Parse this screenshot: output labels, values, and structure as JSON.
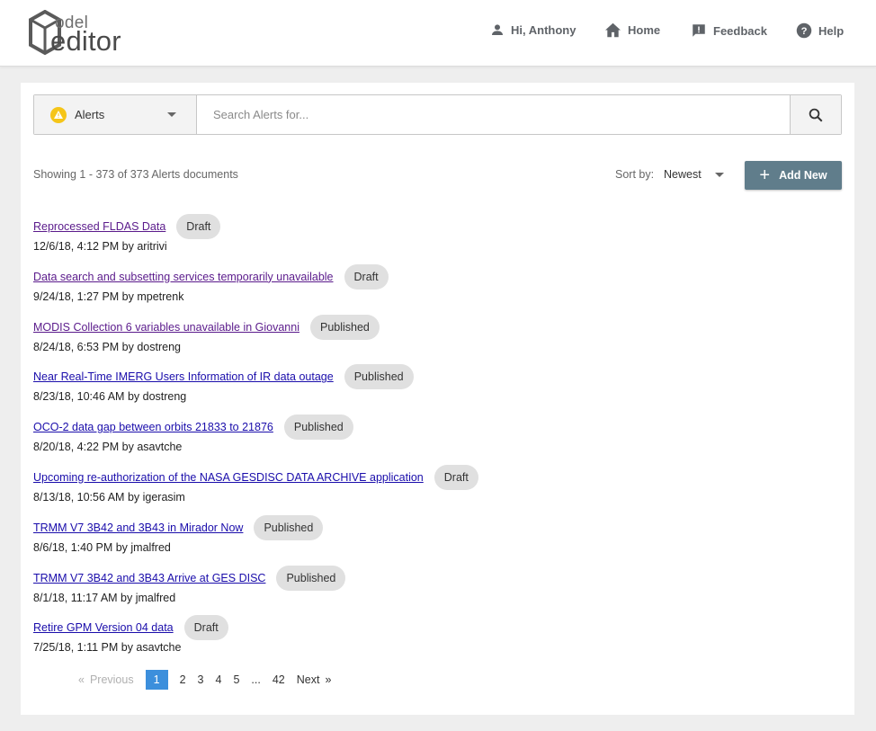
{
  "header": {
    "logo_small": "odel",
    "logo_big": "editor",
    "user_greeting": "Hi, Anthony",
    "home_label": "Home",
    "feedback_label": "Feedback",
    "help_label": "Help"
  },
  "search": {
    "type_selected": "Alerts",
    "placeholder": "Search Alerts for...",
    "value": ""
  },
  "results": {
    "showing_text": "Showing 1 - 373 of 373 Alerts documents",
    "sort_label": "Sort by:",
    "sort_selected": "Newest",
    "add_new_label": "Add New"
  },
  "alerts": [
    {
      "title": "Reprocessed FLDAS Data",
      "status": "Draft",
      "meta": "12/6/18, 4:12 PM by aritrivi",
      "visited": true
    },
    {
      "title": "Data search and subsetting services temporarily unavailable",
      "status": "Draft",
      "meta": "9/24/18, 1:27 PM by mpetrenk",
      "visited": true
    },
    {
      "title": "MODIS Collection 6 variables unavailable in Giovanni",
      "status": "Published",
      "meta": "8/24/18, 6:53 PM by dostreng",
      "visited": true
    },
    {
      "title": "Near Real-Time IMERG Users Information of IR data outage",
      "status": "Published",
      "meta": "8/23/18, 10:46 AM by dostreng",
      "visited": false
    },
    {
      "title": "OCO-2 data gap between orbits 21833 to 21876",
      "status": "Published",
      "meta": "8/20/18, 4:22 PM by asavtche",
      "visited": false
    },
    {
      "title": "Upcoming re-authorization of the NASA GESDISC DATA ARCHIVE application",
      "status": "Draft",
      "meta": "8/13/18, 10:56 AM by igerasim",
      "visited": false
    },
    {
      "title": "TRMM V7 3B42 and 3B43 in Mirador Now",
      "status": "Published",
      "meta": "8/6/18, 1:40 PM by jmalfred",
      "visited": false
    },
    {
      "title": "TRMM V7 3B42 and 3B43 Arrive at GES DISC",
      "status": "Published",
      "meta": "8/1/18, 11:17 AM by jmalfred",
      "visited": false
    },
    {
      "title": "Retire GPM Version 04 data",
      "status": "Draft",
      "meta": "7/25/18, 1:11 PM by asavtche",
      "visited": false
    }
  ],
  "pagination": {
    "prev_arrow": "«",
    "prev_label": "Previous",
    "pages": [
      "1",
      "2",
      "3",
      "4",
      "5",
      "...",
      "42"
    ],
    "current_page": 1,
    "next_label": "Next",
    "next_arrow": "»"
  },
  "colors": {
    "accent_button": "#607d8b",
    "active_page": "#3c8fdc",
    "link": "#1a0dab",
    "link_visited": "#5a1a8b",
    "warning": "#f5c518"
  },
  "icons": {
    "user": "person-icon",
    "home": "home-icon",
    "feedback": "feedback-icon",
    "help": "help-icon",
    "alert_type": "warning-icon",
    "search": "search-icon",
    "add": "plus-icon"
  }
}
